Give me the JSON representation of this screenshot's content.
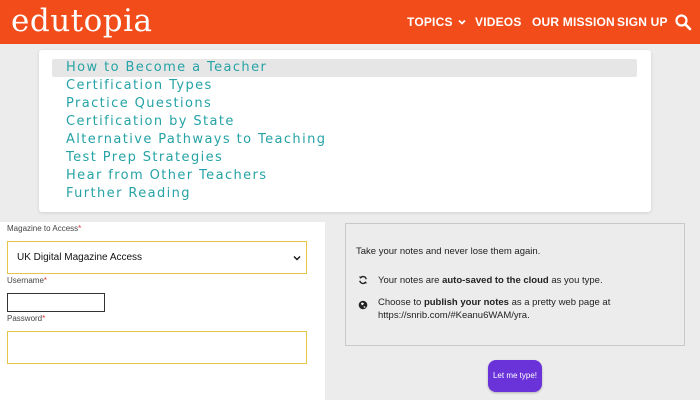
{
  "header": {
    "logo": "edutopia",
    "nav": [
      "TOPICS",
      "VIDEOS",
      "OUR MISSION",
      "SIGN UP"
    ],
    "brand_color": "#f14c1a"
  },
  "menu": {
    "items": [
      "How to Become a Teacher",
      "Certification Types",
      "Practice Questions",
      "Certification by State",
      "Alternative Pathways to Teaching",
      "Test Prep Strategies",
      "Hear from Other Teachers",
      "Further Reading"
    ],
    "active_index": 0,
    "link_color": "#26a3a6"
  },
  "form": {
    "magazine_label": "Magazine to Access",
    "magazine_value": "UK Digital Magazine Access",
    "username_label": "Username",
    "username_value": "",
    "password_label": "Password",
    "password_value": "",
    "required_mark": "*"
  },
  "notes": {
    "title": "Take your notes and never lose them again.",
    "feature1_pre": "Your notes are ",
    "feature1_bold": "auto-saved to the cloud",
    "feature1_post": " as you type.",
    "feature2_pre": "Choose to ",
    "feature2_bold": "publish your notes",
    "feature2_post": " as a pretty web page at https://snrib.com/#Keanu6WAM/yra.",
    "cta_label": "Let me type!",
    "cta_color": "#6a33d9"
  }
}
